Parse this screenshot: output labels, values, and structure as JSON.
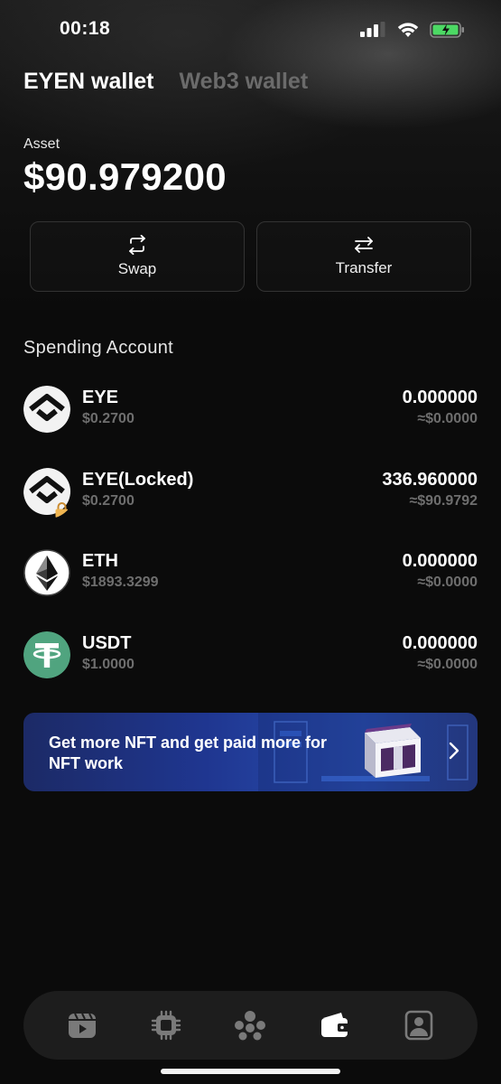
{
  "status_bar": {
    "time": "00:18"
  },
  "tabs": [
    {
      "label": "EYEN wallet",
      "active": true
    },
    {
      "label": "Web3 wallet",
      "active": false
    }
  ],
  "asset": {
    "label": "Asset",
    "value": "$90.979200"
  },
  "actions": {
    "swap_label": "Swap",
    "transfer_label": "Transfer"
  },
  "spending": {
    "title": "Spending Account",
    "tokens": [
      {
        "name": "EYE",
        "price": "$0.2700",
        "amount": "0.000000",
        "fiat": "≈$0.0000",
        "icon": "eye-token-icon"
      },
      {
        "name": "EYE(Locked)",
        "price": "$0.2700",
        "amount": "336.960000",
        "fiat": "≈$90.9792",
        "icon": "eye-locked-token-icon"
      },
      {
        "name": "ETH",
        "price": "$1893.3299",
        "amount": "0.000000",
        "fiat": "≈$0.0000",
        "icon": "eth-icon"
      },
      {
        "name": "USDT",
        "price": "$1.0000",
        "amount": "0.000000",
        "fiat": "≈$0.0000",
        "icon": "usdt-icon"
      }
    ]
  },
  "banner": {
    "text": "Get more NFT and get paid more for NFT work"
  },
  "bottom_nav": [
    {
      "name": "video-icon",
      "active": false
    },
    {
      "name": "chip-icon",
      "active": false
    },
    {
      "name": "community-icon",
      "active": false
    },
    {
      "name": "wallet-icon",
      "active": true
    },
    {
      "name": "profile-icon",
      "active": false
    }
  ],
  "colors": {
    "background": "#0b0b0b",
    "muted_text": "#6e6e6e",
    "usdt_green": "#50a47f",
    "banner_blue": "#1f3690"
  }
}
